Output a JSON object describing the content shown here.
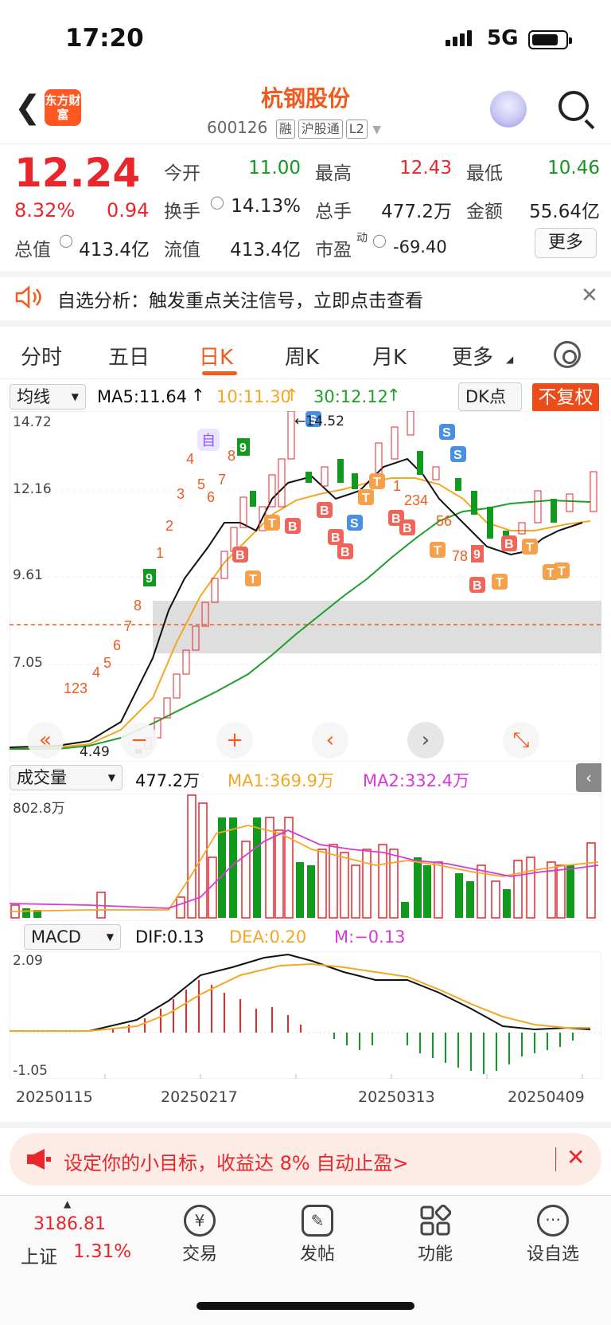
{
  "status": {
    "time": "17:20",
    "network": "5G"
  },
  "header": {
    "logo_text": "东方财富",
    "stock_name": "杭钢股份",
    "stock_code": "600126",
    "tags": [
      "融",
      "沪股通",
      "L2"
    ]
  },
  "quote": {
    "price": "12.24",
    "change_pct": "8.32%",
    "change_val": "0.94",
    "fields": [
      {
        "label": "今开",
        "value": "11.00",
        "color": "#129a1f"
      },
      {
        "label": "最高",
        "value": "12.43",
        "color": "#e8262b"
      },
      {
        "label": "最低",
        "value": "10.46",
        "color": "#129a1f"
      },
      {
        "label": "换手",
        "value": "14.13%",
        "color": "#222222"
      },
      {
        "label": "总手",
        "value": "477.2万",
        "color": "#222222"
      },
      {
        "label": "金额",
        "value": "55.64亿",
        "color": "#222222"
      },
      {
        "label": "总值",
        "value": "413.4亿",
        "color": "#222222"
      },
      {
        "label": "流值",
        "value": "413.4亿",
        "color": "#222222"
      },
      {
        "label": "市盈",
        "value": "-69.40",
        "color": "#222222",
        "sup": "动"
      }
    ],
    "more_label": "更多"
  },
  "notice": {
    "text": "自选分析：触发重点关注信号，立即点击查看"
  },
  "tabs": [
    {
      "label": "分时"
    },
    {
      "label": "五日"
    },
    {
      "label": "日K",
      "active": true
    },
    {
      "label": "周K"
    },
    {
      "label": "月K"
    },
    {
      "label": "更多"
    }
  ],
  "kline": {
    "indicator": "均线",
    "ma5": "MA5:11.64",
    "ma10": "10:11.30",
    "ma30": "30:12.12",
    "dk_label": "DK点",
    "fq_label": "不复权",
    "y_ticks": [
      "14.72",
      "12.16",
      "9.61",
      "7.05"
    ],
    "high_label": "14.52",
    "low_label": "4.49",
    "self_mark": "自",
    "colors": {
      "up": "#e8262b",
      "down": "#129a1f",
      "ma5": "#111111",
      "ma10": "#f5a623",
      "ma30": "#1e9e2a",
      "signal_b": "#f0655a",
      "signal_t": "#f5a04a",
      "signal_s": "#4a90e2"
    },
    "controls": [
      "«",
      "−",
      "+",
      "‹",
      "›",
      "⤡"
    ]
  },
  "volume": {
    "indicator": "成交量",
    "current": "477.2万",
    "ma1": "MA1:369.9万",
    "ma2": "MA2:332.4万",
    "y_max": "802.8万"
  },
  "macd": {
    "indicator": "MACD",
    "dif": "DIF:0.13",
    "dea": "DEA:0.20",
    "m": "M:−0.13",
    "y_max": "2.09",
    "y_min": "-1.05",
    "dates": [
      "20250115",
      "20250217",
      "20250313",
      "20250409"
    ]
  },
  "promo": {
    "text": "设定你的小目标，收益达 8% 自动止盈>"
  },
  "bottom_nav": {
    "index_value": "3186.81",
    "index_name": "上证",
    "index_pct": "1.31%",
    "items": [
      {
        "label": "交易"
      },
      {
        "label": "发帖"
      },
      {
        "label": "功能"
      },
      {
        "label": "设自选"
      }
    ]
  }
}
